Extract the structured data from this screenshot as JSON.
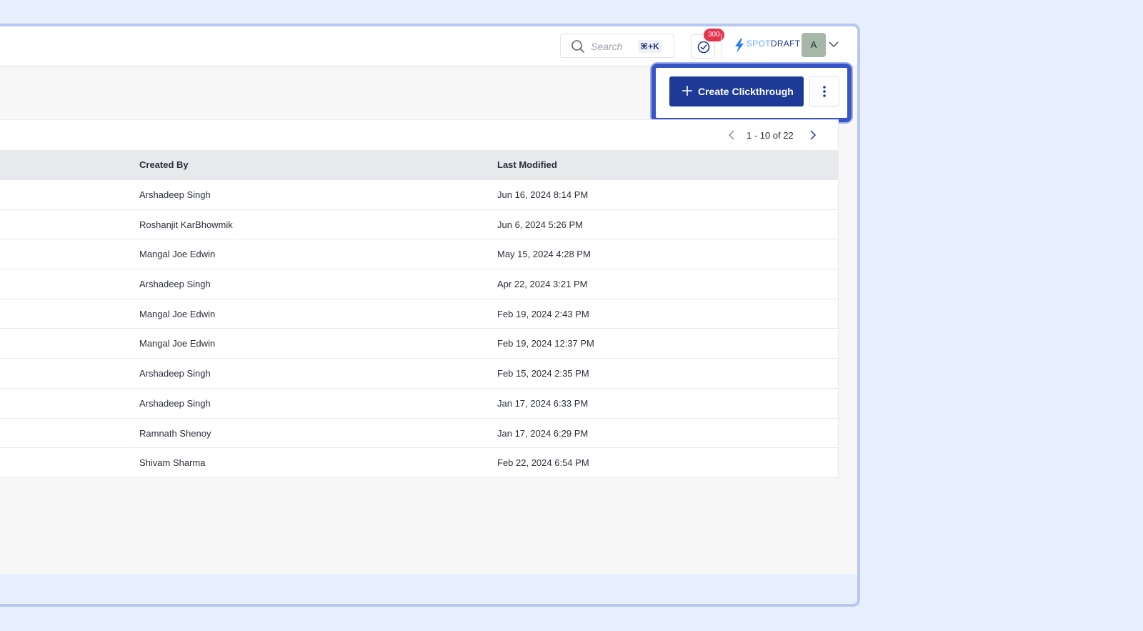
{
  "header": {
    "search": {
      "placeholder": "Search",
      "shortcut": "⌘+K"
    },
    "tasks": {
      "badge_count": "300"
    },
    "brand": {
      "part1": "SPOT",
      "part2": "DRAFT"
    },
    "user": {
      "avatar_initial": "A"
    }
  },
  "actions": {
    "create_label": "Create Clickthrough"
  },
  "pagination": {
    "text": "1 - 10 of 22"
  },
  "table": {
    "columns": {
      "created_by": "Created By",
      "last_modified": "Last Modified"
    },
    "rows": [
      {
        "created_by": "Arshadeep Singh",
        "last_modified": "Jun 16, 2024 8:14 PM"
      },
      {
        "created_by": "Roshanjit KarBhowmik",
        "last_modified": "Jun 6, 2024 5:26 PM"
      },
      {
        "created_by": "Mangal Joe Edwin",
        "last_modified": "May 15, 2024 4:28 PM"
      },
      {
        "created_by": "Arshadeep Singh",
        "last_modified": "Apr 22, 2024 3:21 PM"
      },
      {
        "created_by": "Mangal Joe Edwin",
        "last_modified": "Feb 19, 2024 2:43 PM"
      },
      {
        "created_by": "Mangal Joe Edwin",
        "last_modified": "Feb 19, 2024 12:37 PM"
      },
      {
        "created_by": "Arshadeep Singh",
        "last_modified": "Feb 15, 2024 2:35 PM"
      },
      {
        "created_by": "Arshadeep Singh",
        "last_modified": "Jan 17, 2024 6:33 PM"
      },
      {
        "created_by": "Ramnath Shenoy",
        "last_modified": "Jan 17, 2024 6:29 PM"
      },
      {
        "created_by": "Shivam Sharma",
        "last_modified": "Feb 22, 2024 6:54 PM"
      }
    ]
  },
  "colors": {
    "primary": "#1d3a96",
    "badge": "#e5334b",
    "highlight": "#3a55c8",
    "avatar": "#a7b7a7"
  },
  "icons": [
    "search-icon",
    "task-check-icon",
    "bolt-icon",
    "chevron-down-icon",
    "plus-icon",
    "more-vertical-icon",
    "chevron-left-icon",
    "chevron-right-icon"
  ]
}
